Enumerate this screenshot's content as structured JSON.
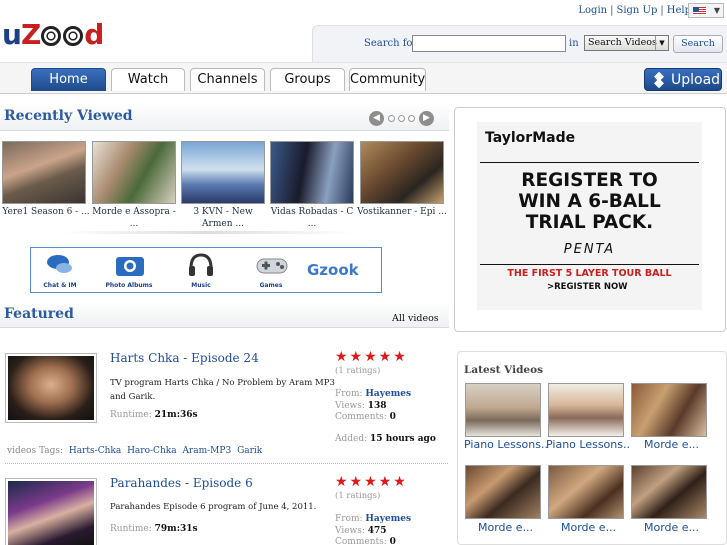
{
  "header": {
    "logo": {
      "u": "u",
      "z": "Z",
      "d": "d"
    },
    "links": [
      "Login",
      "Sign Up",
      "Help"
    ],
    "search_label": "Search for",
    "search_value": "",
    "in_label": "in",
    "search_scope": "Search Videos",
    "search_button": "Search"
  },
  "nav": {
    "tabs": [
      "Home",
      "Watch",
      "Channels",
      "Groups",
      "Community"
    ],
    "active": "Home",
    "upload": "Upload"
  },
  "recently_viewed": {
    "title": "Recently Viewed",
    "items": [
      {
        "caption": "Yere1 Season 6 - ..."
      },
      {
        "caption": "Morde e Assopra - ..."
      },
      {
        "caption": "3 KVN - New Armen ..."
      },
      {
        "caption": "Vidas Robadas - C ..."
      },
      {
        "caption": "Vostikanner - Epi ..."
      }
    ]
  },
  "icon_strip": {
    "items": [
      "Chat & IM",
      "Photo Albums",
      "Music",
      "Games"
    ],
    "brand": "Gzook"
  },
  "featured": {
    "title": "Featured",
    "all_link": "All videos",
    "videos": [
      {
        "title": "Harts Chka - Episode 24",
        "description": "TV program Harts Chka / No Problem by Aram MP3 and Garik.",
        "runtime_label": "Runtime:",
        "runtime": "21m:36s",
        "stars": "★★★★★",
        "ratings": "(1 ratings)",
        "from_label": "From:",
        "from": "Hayemes",
        "views_label": "Views:",
        "views": "138",
        "comments_label": "Comments:",
        "comments": "0",
        "added_label": "Added:",
        "added": "15 hours ago",
        "tags_label": "videos Tags:",
        "tags": [
          "Harts-Chka",
          "Haro-Chka",
          "Aram-MP3",
          "Garik"
        ]
      },
      {
        "title": "Parahandes - Episode 6",
        "description": "Parahandes Episode 6 program of June 4, 2011.",
        "runtime_label": "Runtime:",
        "runtime": "79m:31s",
        "stars": "★★★★★",
        "ratings": "(1 ratings)",
        "from_label": "From:",
        "from": "Hayemes",
        "views_label": "Views:",
        "views": "475",
        "comments_label": "Comments:",
        "comments": "0"
      }
    ]
  },
  "ad": {
    "brand": "TaylorMade",
    "line1": "REGISTER TO",
    "line2": "WIN A 6-BALL",
    "line3": "TRIAL PACK.",
    "product": "PENTA",
    "tagline": "THE FIRST 5 LAYER TOUR BALL",
    "cta": ">REGISTER NOW"
  },
  "latest": {
    "title": "Latest Videos",
    "items": [
      {
        "caption": "Piano Lessons..."
      },
      {
        "caption": "Piano Lessons..."
      },
      {
        "caption": "Morde e..."
      },
      {
        "caption": "Morde e..."
      },
      {
        "caption": "Morde e..."
      },
      {
        "caption": "Morde e..."
      }
    ]
  }
}
